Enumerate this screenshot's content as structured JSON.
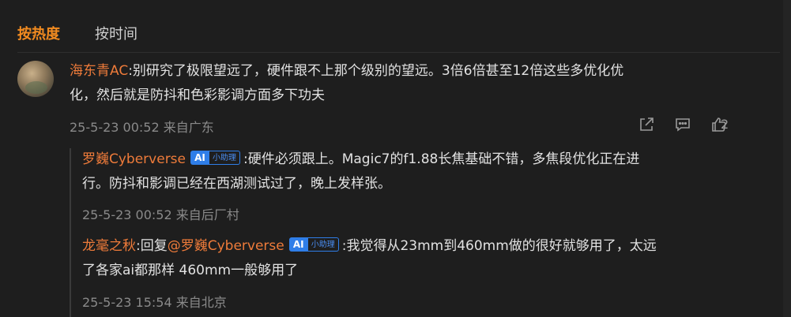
{
  "tabs": {
    "hot": "按热度",
    "time": "按时间"
  },
  "main_comment": {
    "user": "海东青AC",
    "text_line1": ":别研究了极限望远了，硬件跟不上那个级别的望远。3倍6倍甚至12倍这些多优化优",
    "text_line2": "化，然后就是防抖和色彩影调方面多下功夫",
    "time": "25-5-23 00:52",
    "location": "来自广东",
    "like_count": "2"
  },
  "reply1": {
    "user": "罗巍Cyberverse",
    "badge_ai": "AI",
    "badge_label": "小助理",
    "text_line1": ":硬件必须跟上。Magic7的f1.88长焦基础不错，多焦段优化正在进",
    "text_line2": "行。防抖和影调已经在西湖测试过了，晚上发样张。",
    "time": "25-5-23 00:52",
    "location": "来自后厂村"
  },
  "reply2": {
    "user": "龙毫之秋",
    "reply_prefix": ":回复",
    "mention": "@罗巍Cyberverse",
    "badge_ai": "AI",
    "badge_label": "小助理",
    "text_line1": ":我觉得从23mm到460mm做的很好就够用了，太远",
    "text_line2": "了各家ai都那样  460mm一般够用了",
    "time": "25-5-23 15:54",
    "location": "来自北京"
  },
  "icons": {
    "share": "share-icon",
    "comment": "comment-icon",
    "like": "thumbs-up-icon"
  },
  "colors": {
    "background": "#1e1e1e",
    "accent_orange": "#f28b20",
    "username": "#ee7b3a",
    "badge_blue": "#2f7ee8",
    "meta_gray": "#8a8a8a"
  }
}
